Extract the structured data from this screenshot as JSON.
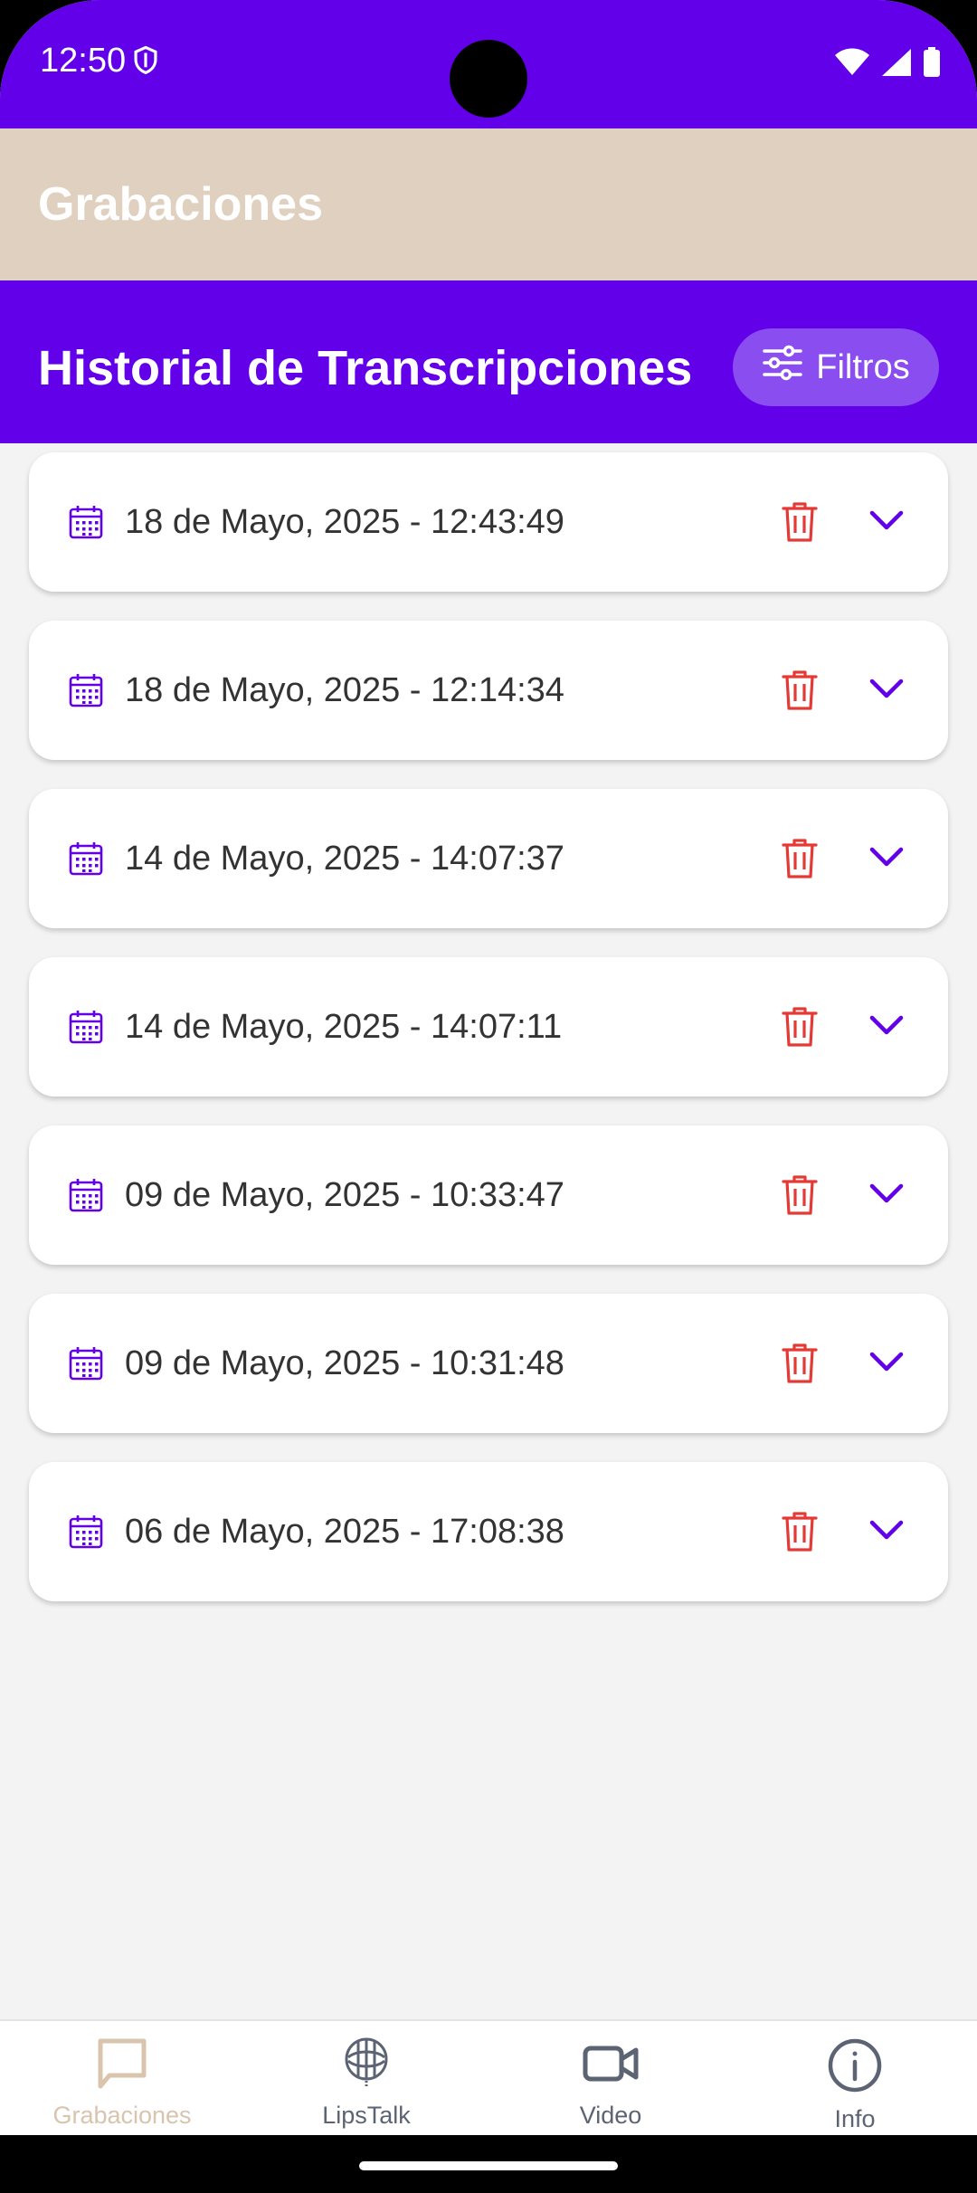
{
  "status_bar": {
    "time": "12:50"
  },
  "app_bar": {
    "title": "Grabaciones"
  },
  "header": {
    "title": "Historial de Transcripciones",
    "filter_label": "Filtros"
  },
  "recordings": [
    {
      "date": "18 de Mayo, 2025 - 12:43:49"
    },
    {
      "date": "18 de Mayo, 2025 - 12:14:34"
    },
    {
      "date": "14 de Mayo, 2025 - 14:07:37"
    },
    {
      "date": "14 de Mayo, 2025 - 14:07:11"
    },
    {
      "date": "09 de Mayo, 2025 - 10:33:47"
    },
    {
      "date": "09 de Mayo, 2025 - 10:31:48"
    },
    {
      "date": "06 de Mayo, 2025 - 17:08:38"
    }
  ],
  "bottom_nav": {
    "items": [
      {
        "label": "Grabaciones",
        "icon": "chat-bubble-icon",
        "active": true
      },
      {
        "label": "LipsTalk",
        "icon": "lips-logo-icon",
        "active": false
      },
      {
        "label": "Video",
        "icon": "video-camera-icon",
        "active": false
      },
      {
        "label": "Info",
        "icon": "info-icon",
        "active": false
      }
    ]
  },
  "colors": {
    "primary": "#6200ea",
    "app_bar": "#e0d0bf",
    "delete": "#e53935",
    "active_nav": "#d9c4ad",
    "inactive_nav": "#5c6474"
  }
}
